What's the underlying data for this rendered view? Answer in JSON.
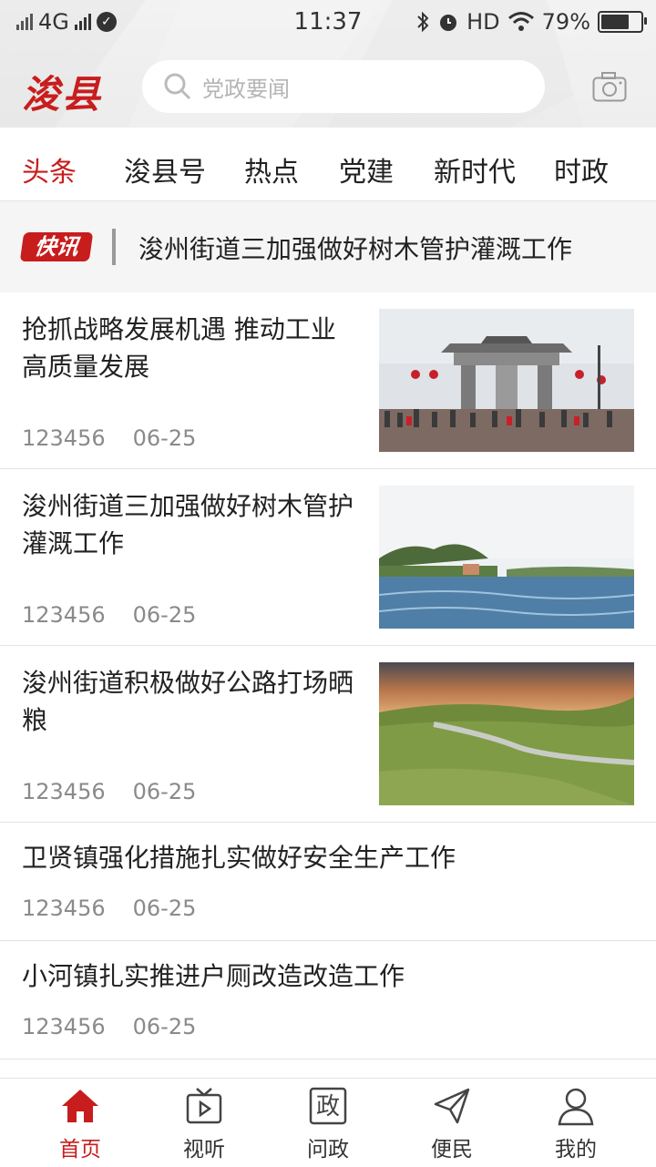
{
  "status_bar": {
    "network": "4G",
    "time": "11:37",
    "hd": "HD",
    "battery": "79%",
    "battery_level": 0.79
  },
  "header": {
    "logo": "浚县",
    "search_placeholder": "党政要闻"
  },
  "tabs": [
    {
      "label": "头条",
      "active": true
    },
    {
      "label": "浚县号"
    },
    {
      "label": "热点"
    },
    {
      "label": "党建"
    },
    {
      "label": "新时代"
    },
    {
      "label": "时政"
    }
  ],
  "flash": {
    "badge": "快讯",
    "text": "浚州街道三加强做好树木管护灌溉工作"
  },
  "news": [
    {
      "title": "抢抓战略发展机遇 推动工业高质量发展",
      "views": "123456",
      "date": "06-25",
      "image": "gate-crowd"
    },
    {
      "title": "浚州街道三加强做好树木管护灌溉工作",
      "views": "123456",
      "date": "06-25",
      "image": "river-landscape"
    },
    {
      "title": "浚州街道积极做好公路打场晒粮",
      "views": "123456",
      "date": "06-25",
      "image": "grassland-sunset"
    },
    {
      "title": "卫贤镇强化措施扎实做好安全生产工作",
      "views": "123456",
      "date": "06-25"
    },
    {
      "title": "小河镇扎实推进户厕改造改造工作",
      "views": "123456",
      "date": "06-25"
    }
  ],
  "bottom_nav": [
    {
      "label": "首页",
      "icon": "home-icon",
      "active": true
    },
    {
      "label": "视听",
      "icon": "tv-icon"
    },
    {
      "label": "问政",
      "icon": "zheng-icon",
      "glyph": "政"
    },
    {
      "label": "便民",
      "icon": "send-icon"
    },
    {
      "label": "我的",
      "icon": "user-icon"
    }
  ],
  "colors": {
    "accent": "#c81d1d",
    "meta": "#8a8a8a",
    "divider": "#e3e3e3"
  }
}
